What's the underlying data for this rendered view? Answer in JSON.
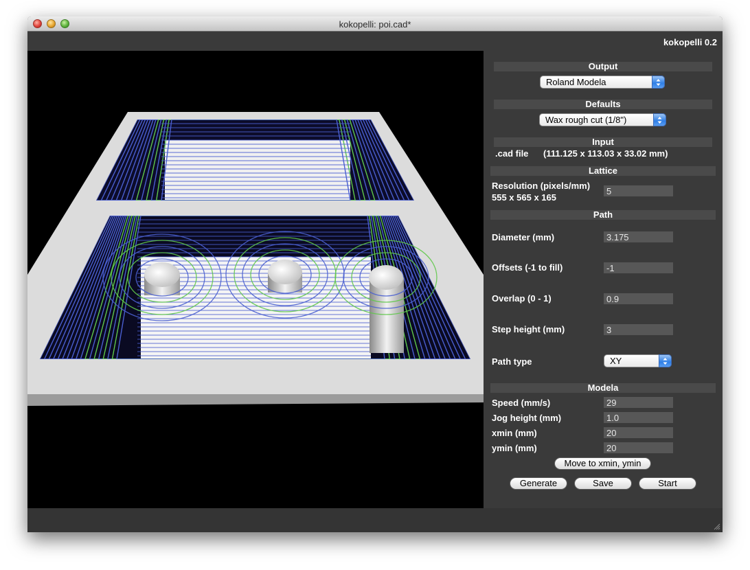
{
  "window": {
    "title": "kokopelli:  poi.cad*",
    "version_label": "kokopelli 0.2"
  },
  "panel": {
    "output": {
      "header": "Output",
      "selected": "Roland Modela"
    },
    "defaults": {
      "header": "Defaults",
      "selected": "Wax rough cut (1/8\")"
    },
    "input": {
      "header": "Input",
      "label": ".cad file",
      "dims": "(111.125 x 113.03 x 33.02 mm)"
    },
    "lattice": {
      "header": "Lattice",
      "resolution_label": "Resolution (pixels/mm)",
      "resolution_value": "5",
      "size": "555 x 565 x 165"
    },
    "path": {
      "header": "Path",
      "diameter_label": "Diameter (mm)",
      "diameter_value": "3.175",
      "offsets_label": "Offsets (-1 to fill)",
      "offsets_value": "-1",
      "overlap_label": "Overlap (0 - 1)",
      "overlap_value": "0.9",
      "step_label": "Step height (mm)",
      "step_value": "3",
      "type_label": "Path type",
      "type_value": "XY"
    },
    "modela": {
      "header": "Modela",
      "speed_label": "Speed (mm/s)",
      "speed_value": "29",
      "jog_label": "Jog height (mm)",
      "jog_value": "1.0",
      "xmin_label": "xmin (mm)",
      "xmin_value": "20",
      "ymin_label": "ymin (mm)",
      "ymin_value": "20",
      "move_button": "Move to xmin, ymin"
    },
    "actions": {
      "generate": "Generate",
      "save": "Save",
      "start": "Start"
    }
  },
  "colors": {
    "toolpath_blue": "#4a5fd0",
    "toolpath_green": "#5fc84a",
    "panel_bg": "#3a3a3a",
    "section_bar": "#4a4a4a"
  }
}
